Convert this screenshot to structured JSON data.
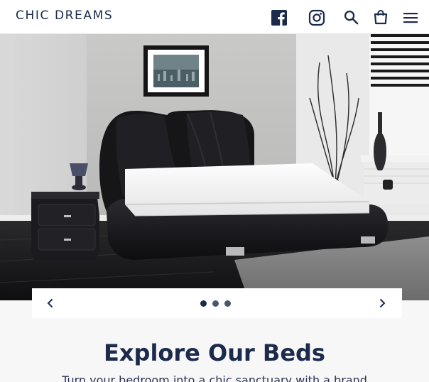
{
  "header": {
    "logo": "CHIC DREAMS",
    "icons": [
      "facebook-icon",
      "instagram-icon",
      "search-icon",
      "cart-icon",
      "menu-icon"
    ]
  },
  "hero": {
    "image": "black-leather-bed-bedroom-photo",
    "slides": 3,
    "active_slide": 1
  },
  "section": {
    "title": "Explore Our Beds",
    "text": "Turn your bedroom into a chic sanctuary with a brand"
  },
  "colors": {
    "brand": "#1c2a4b",
    "background": "#f7f7f7",
    "header_bg": "#ffffff"
  }
}
